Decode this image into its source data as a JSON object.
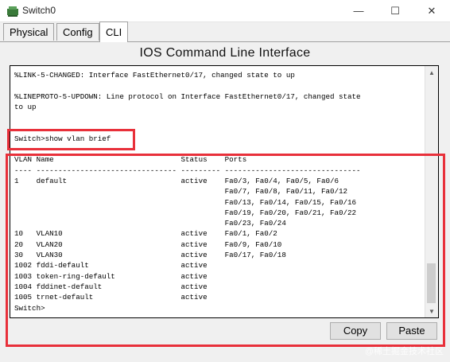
{
  "window": {
    "title": "Switch0",
    "icon": "cisco-switch-icon",
    "controls": {
      "minimize": "—",
      "maximize": "☐",
      "close": "✕"
    }
  },
  "tabs": [
    {
      "label": "Physical",
      "active": false
    },
    {
      "label": "Config",
      "active": false
    },
    {
      "label": "CLI",
      "active": true
    }
  ],
  "panel_title": "IOS Command Line Interface",
  "terminal": {
    "lines": [
      "%LINK-5-CHANGED: Interface FastEthernet0/17, changed state to up",
      "",
      "%LINEPROTO-5-UPDOWN: Line protocol on Interface FastEthernet0/17, changed state",
      "to up",
      "",
      "",
      "Switch>show vlan brief",
      "",
      "VLAN Name                             Status    Ports",
      "---- -------------------------------- --------- -------------------------------",
      "1    default                          active    Fa0/3, Fa0/4, Fa0/5, Fa0/6",
      "                                                Fa0/7, Fa0/8, Fa0/11, Fa0/12",
      "                                                Fa0/13, Fa0/14, Fa0/15, Fa0/16",
      "                                                Fa0/19, Fa0/20, Fa0/21, Fa0/22",
      "                                                Fa0/23, Fa0/24",
      "10   VLAN10                           active    Fa0/1, Fa0/2",
      "20   VLAN20                           active    Fa0/9, Fa0/10",
      "30   VLAN30                           active    Fa0/17, Fa0/18",
      "1002 fddi-default                     active",
      "1003 token-ring-default               active",
      "1004 fddinet-default                  active",
      "1005 trnet-default                    active",
      "Switch>"
    ]
  },
  "buttons": {
    "copy": "Copy",
    "paste": "Paste"
  },
  "watermark": "@稀土掘金技术社区",
  "colors": {
    "highlight": "#e8303a",
    "terminal_bg": "#ffffff"
  }
}
